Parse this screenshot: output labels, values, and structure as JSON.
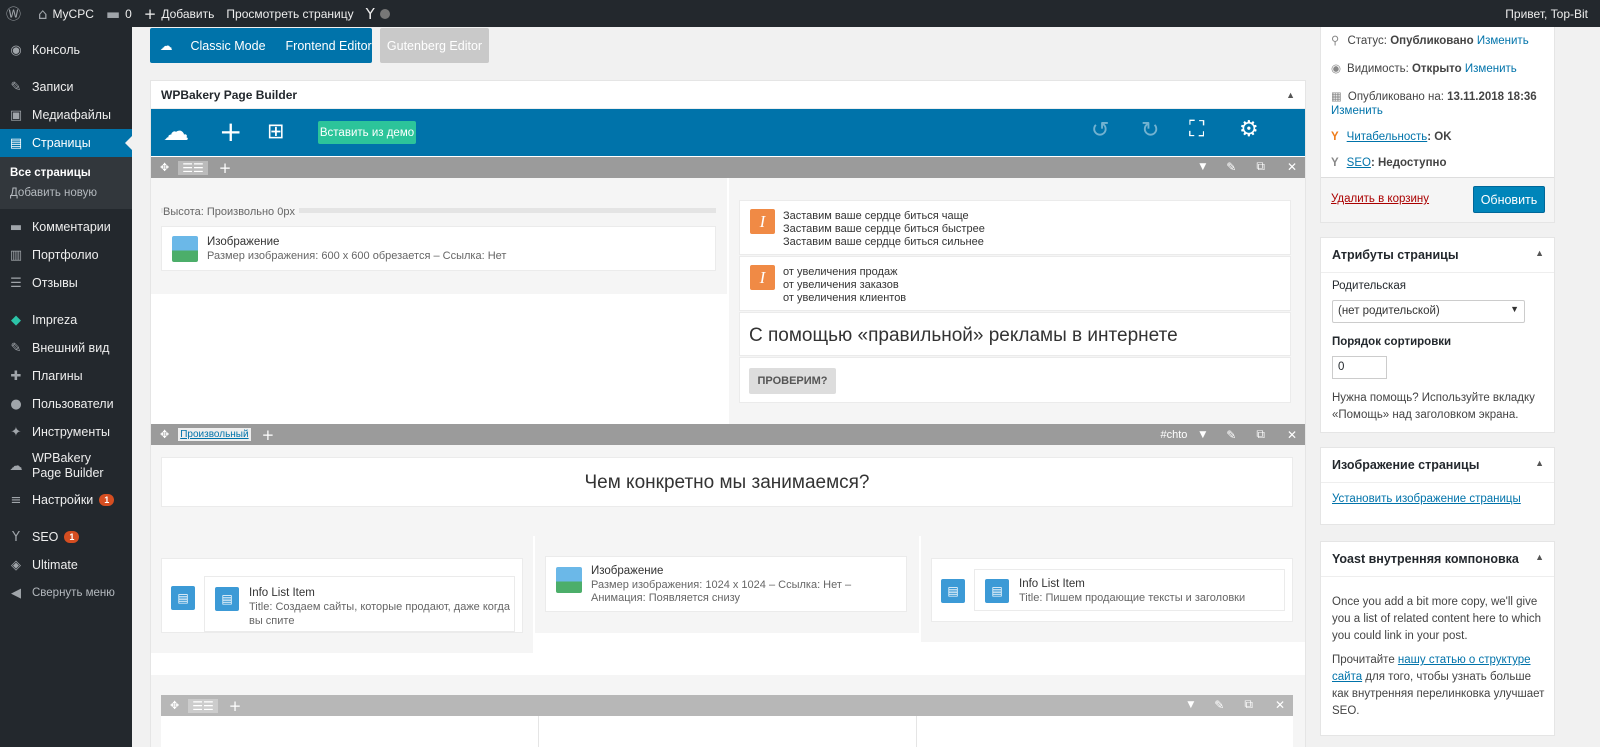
{
  "adminbar": {
    "site": "MyCPC",
    "comments": "0",
    "add": "Добавить",
    "view": "Просмотреть страницу",
    "greeting": "Привет, Top-Bit"
  },
  "sidebar": {
    "items": [
      {
        "icon": "◉",
        "label": "Консоль"
      },
      {
        "icon": "✎",
        "label": "Записи"
      },
      {
        "icon": "▣",
        "label": "Медиафайлы"
      },
      {
        "icon": "▤",
        "label": "Страницы"
      },
      {
        "icon": "▬",
        "label": "Комментарии"
      },
      {
        "icon": "▥",
        "label": "Портфолио"
      },
      {
        "icon": "☰",
        "label": "Отзывы"
      },
      {
        "icon": "◆",
        "label": "Impreza"
      },
      {
        "icon": "✎",
        "label": "Внешний вид"
      },
      {
        "icon": "✚",
        "label": "Плагины"
      },
      {
        "icon": "●",
        "label": "Пользователи"
      },
      {
        "icon": "✦",
        "label": "Инструменты"
      },
      {
        "icon": "☁",
        "label": "WPBakery Page Builder"
      },
      {
        "icon": "≡",
        "label": "Настройки",
        "badge": "1"
      },
      {
        "icon": "Y",
        "label": "SEO",
        "badge": "1"
      },
      {
        "icon": "◈",
        "label": "Ultimate"
      },
      {
        "icon": "◀",
        "label": "Свернуть меню"
      }
    ],
    "sub": [
      "Все страницы",
      "Добавить новую"
    ]
  },
  "editor": {
    "classic": "Classic Mode",
    "frontend": "Frontend Editor",
    "gutenberg": "Gutenberg Editor",
    "panel_title": "WPBakery Page Builder",
    "insert_demo": "Вставить из демо",
    "height_label": "Высота: Произвольно  0px",
    "img1_title": "Изображение",
    "img1_meta": "Размер изображения: 600 x 600 обрезается  –  Ссылка: Нет",
    "list1": [
      "Заставим ваше сердце биться чаще",
      "Заставим ваше сердце биться быстрее",
      "Заставим ваше сердце биться сильнее"
    ],
    "list2": [
      "от увеличения продаж",
      "от увеличения заказов",
      "от увеличения клиентов"
    ],
    "heading1": "С помощью «правильной» рекламы в интернете",
    "check_btn": "ПРОВЕРИМ?",
    "row2_label": "Произвольный",
    "row2_id": "#chto",
    "heading2": "Чем конкретно мы занимаемся?",
    "info1_title": "Info List Item",
    "info1_meta": "Title: Создаем сайты, которые продают, даже когда вы спите",
    "img2_title": "Изображение",
    "img2_meta1": "Размер изображения: 1024 x 1024  –  Ссылка: Нет  –",
    "img2_meta2": "Анимация: Появляется снизу",
    "info2_title": "Info List Item",
    "info2_meta": "Title: Пишем продающие тексты и заголовки"
  },
  "publish": {
    "status_label": "Статус:",
    "status": "Опубликовано",
    "change": "Изменить",
    "vis_label": "Видимость:",
    "vis": "Открыто",
    "pub_label": "Опубликовано на:",
    "pub_date": "13.11.2018 18:36",
    "read_label": "Читабельность",
    "read_val": ": OK",
    "seo_label": "SEO",
    "seo_val": ": Недоступно",
    "trash": "Удалить в корзину",
    "update": "Обновить"
  },
  "attributes": {
    "title": "Атрибуты страницы",
    "parent_label": "Родительская",
    "parent_value": "(нет родительской)",
    "order_label": "Порядок сортировки",
    "order_value": "0",
    "help": "Нужна помощь? Используйте вкладку «Помощь» над заголовком экрана."
  },
  "featured": {
    "title": "Изображение страницы",
    "link": "Установить изображение страницы"
  },
  "yoast": {
    "title": "Yoast внутренняя компоновка",
    "text1": "Once you add a bit more copy, we'll give you a list of related content here to which you could link in your post.",
    "text2a": "Прочитайте ",
    "text2link": "нашу статью о структуре сайта",
    "text2b": " для того, чтобы узнать больше как внутренняя перелинковка улучшает SEO."
  }
}
